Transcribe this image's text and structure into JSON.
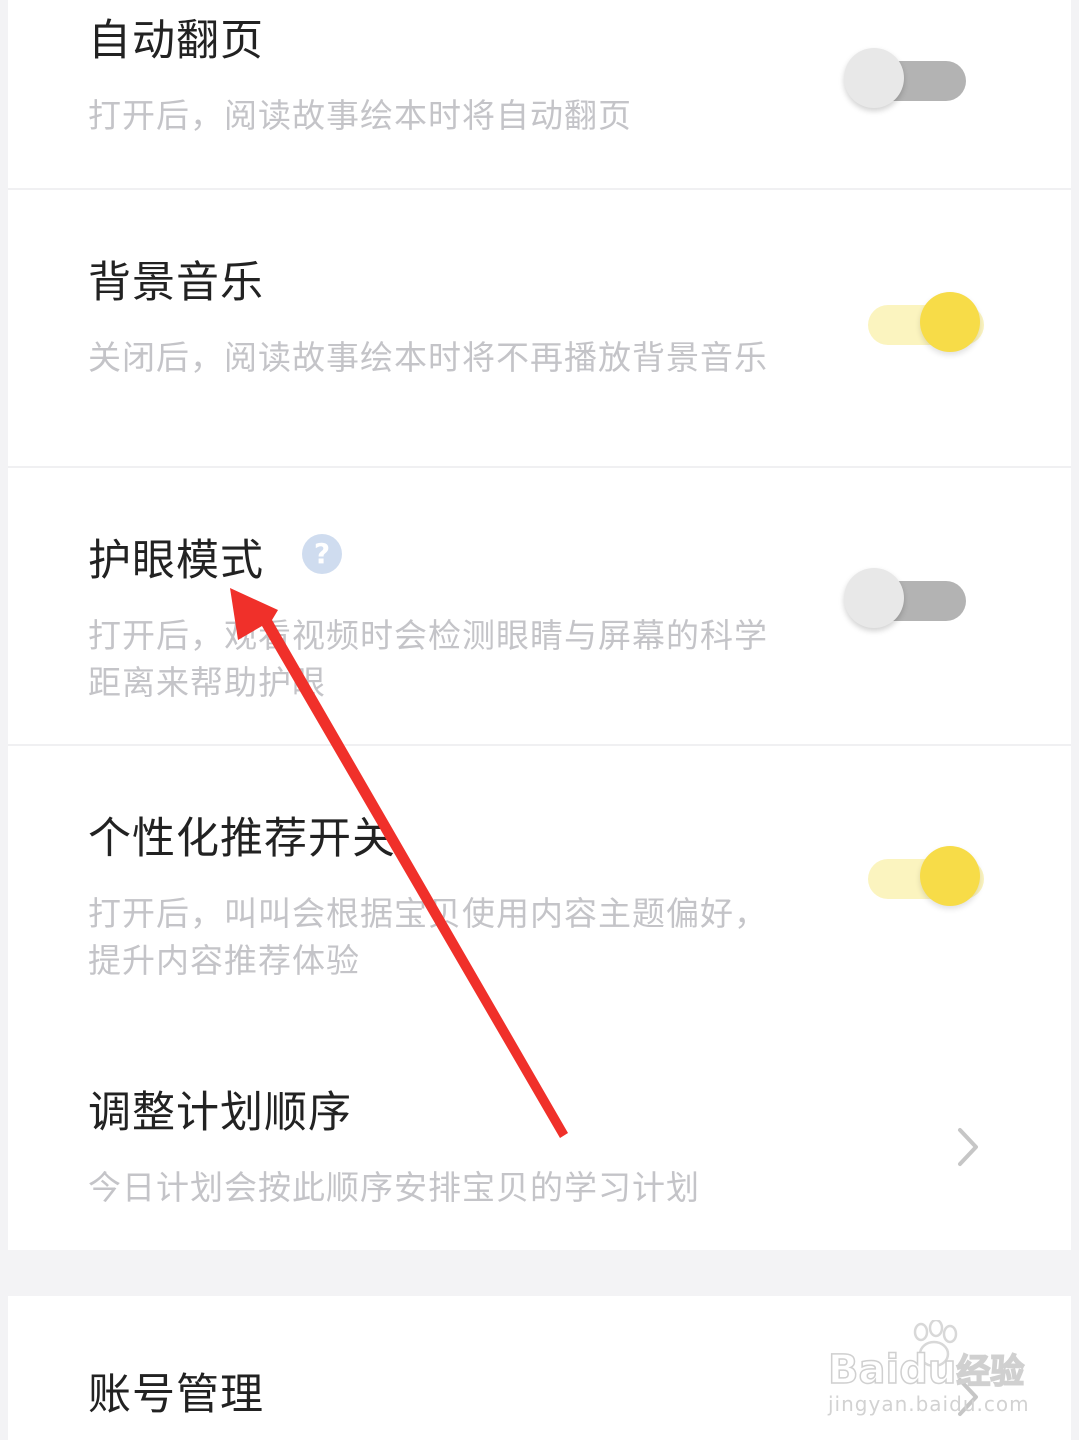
{
  "settings": [
    {
      "title": "自动翻页",
      "desc": "打开后，阅读故事绘本时将自动翻页",
      "control": "toggle",
      "enabled": false
    },
    {
      "title": "背景音乐",
      "desc": "关闭后，阅读故事绘本时将不再播放背景音乐",
      "control": "toggle",
      "enabled": true
    },
    {
      "title": "护眼模式",
      "desc": "打开后，观看视频时会检测眼睛与屏幕的科学距离来帮助护眼",
      "control": "toggle",
      "enabled": false,
      "help_icon": "question-circle-icon",
      "help_glyph": "?"
    },
    {
      "title": "个性化推荐开关",
      "desc": "打开后，叫叫会根据宝贝使用内容主题偏好，提升内容推荐体验",
      "control": "toggle",
      "enabled": true
    },
    {
      "title": "调整计划顺序",
      "desc": "今日计划会按此顺序安排宝贝的学习计划",
      "control": "chevron-right-icon"
    }
  ],
  "account": {
    "title": "账号管理",
    "control": "chevron-right-icon"
  },
  "annotation": {
    "icon": "red-arrow-icon",
    "color": "#f0302a"
  },
  "watermark": {
    "brand": "Bai",
    "brand2": "du",
    "suffix": "经验",
    "url": "jingyan.baidu.com"
  },
  "colors": {
    "toggle_on": "#f7dc48",
    "toggle_on_track": "#fbf4bf",
    "toggle_off_track": "#b3b3b3"
  }
}
